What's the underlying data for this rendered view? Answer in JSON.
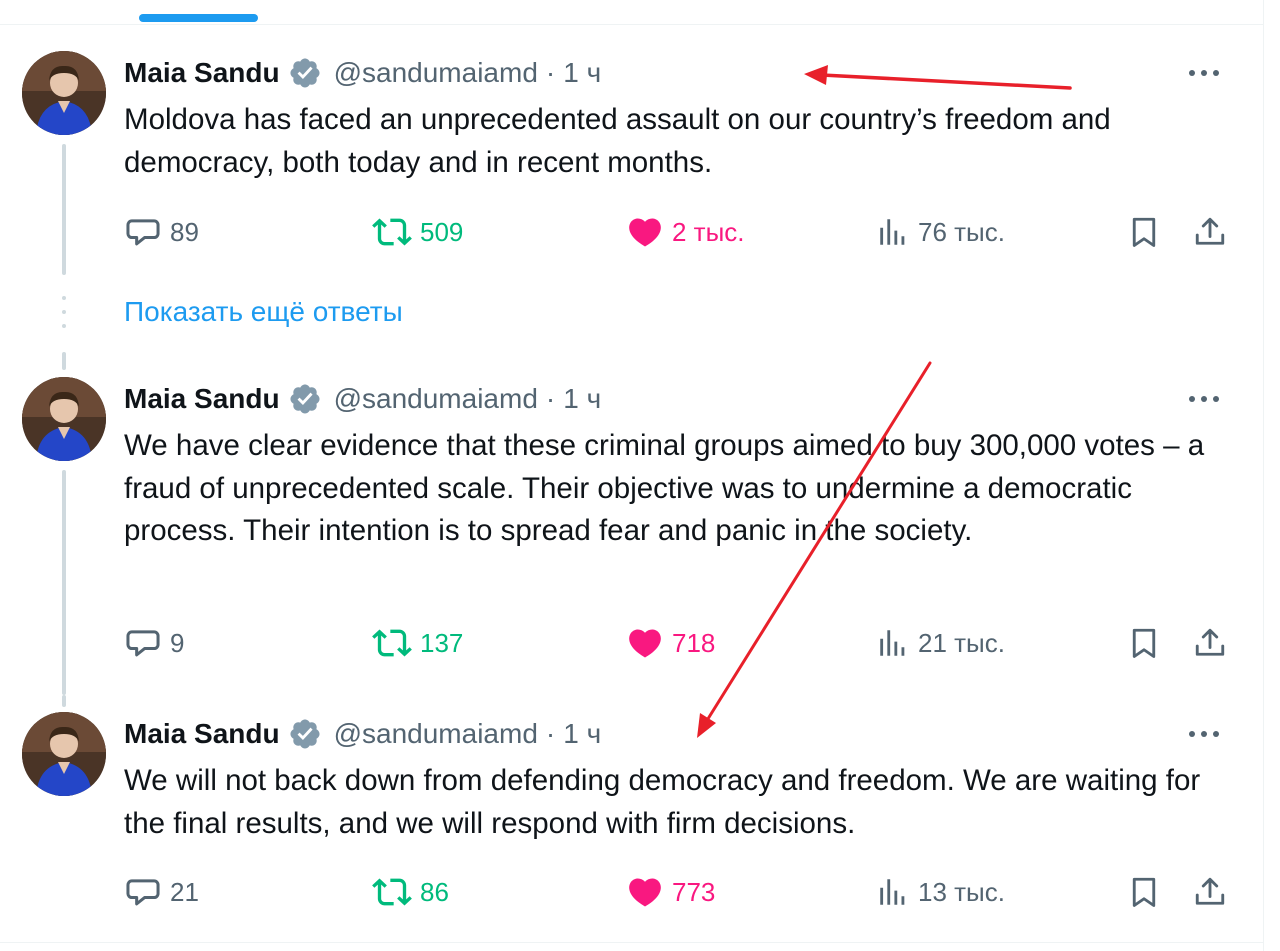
{
  "tweets": [
    {
      "name": "Maia Sandu",
      "handle": "@sandumaiamd",
      "separator": "·",
      "time": "1 ч",
      "text": "Moldova has faced an unprecedented assault on our country’s freedom and democracy, both today and in recent months.",
      "replies": "89",
      "retweets": "509",
      "likes": "2 тыс.",
      "views": "76 тыс."
    },
    {
      "name": "Maia Sandu",
      "handle": "@sandumaiamd",
      "separator": "·",
      "time": "1 ч",
      "text": "We have clear evidence that these criminal groups aimed to buy 300,000 votes – a fraud of unprecedented scale. Their objective was to undermine a democratic process. Their intention is to spread fear and panic in the society.",
      "replies": "9",
      "retweets": "137",
      "likes": "718",
      "views": "21 тыс."
    },
    {
      "name": "Maia Sandu",
      "handle": "@sandumaiamd",
      "separator": "·",
      "time": "1 ч",
      "text": "We will not back down from defending democracy and freedom. We are waiting for the final results, and we will respond with firm decisions.",
      "replies": "21",
      "retweets": "86",
      "likes": "773",
      "views": "13 тыс."
    }
  ],
  "show_more_replies": "Показать ещё ответы",
  "colors": {
    "text": "#0f1419",
    "secondary": "#536471",
    "link": "#1d9bf0",
    "retweet": "#00ba7c",
    "like": "#f91880",
    "annotation_arrow": "#e8202a"
  },
  "icons": {
    "verified": "verified-badge-icon",
    "more": "more-dots-icon",
    "reply": "reply-bubble-icon",
    "retweet": "retweet-icon",
    "like": "heart-filled-icon",
    "views": "views-bars-icon",
    "bookmark": "bookmark-icon",
    "share": "share-upload-icon"
  }
}
